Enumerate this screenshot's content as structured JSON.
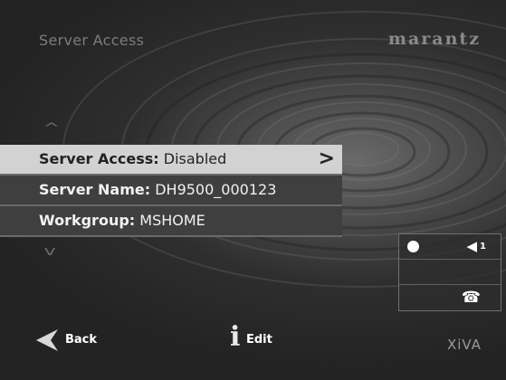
{
  "header": {
    "title": "Server Access",
    "brand": "marantz"
  },
  "menu": {
    "up_arrow": "^",
    "down_arrow": "v",
    "items": [
      {
        "key": "Server Access:",
        "value": "Disabled",
        "selected": true
      },
      {
        "key": "Server Name:",
        "value": "DH9500_000123",
        "selected": false
      },
      {
        "key": "Workgroup:",
        "value": "MSHOME",
        "selected": false
      }
    ],
    "chevron": ">"
  },
  "status": {
    "speaker_glyph": "◀",
    "speaker_number": "1",
    "phone_glyph": "☎"
  },
  "footer": {
    "back_label": "Back",
    "edit_icon": "i",
    "edit_label": "Edit",
    "logo": "XiVA"
  }
}
